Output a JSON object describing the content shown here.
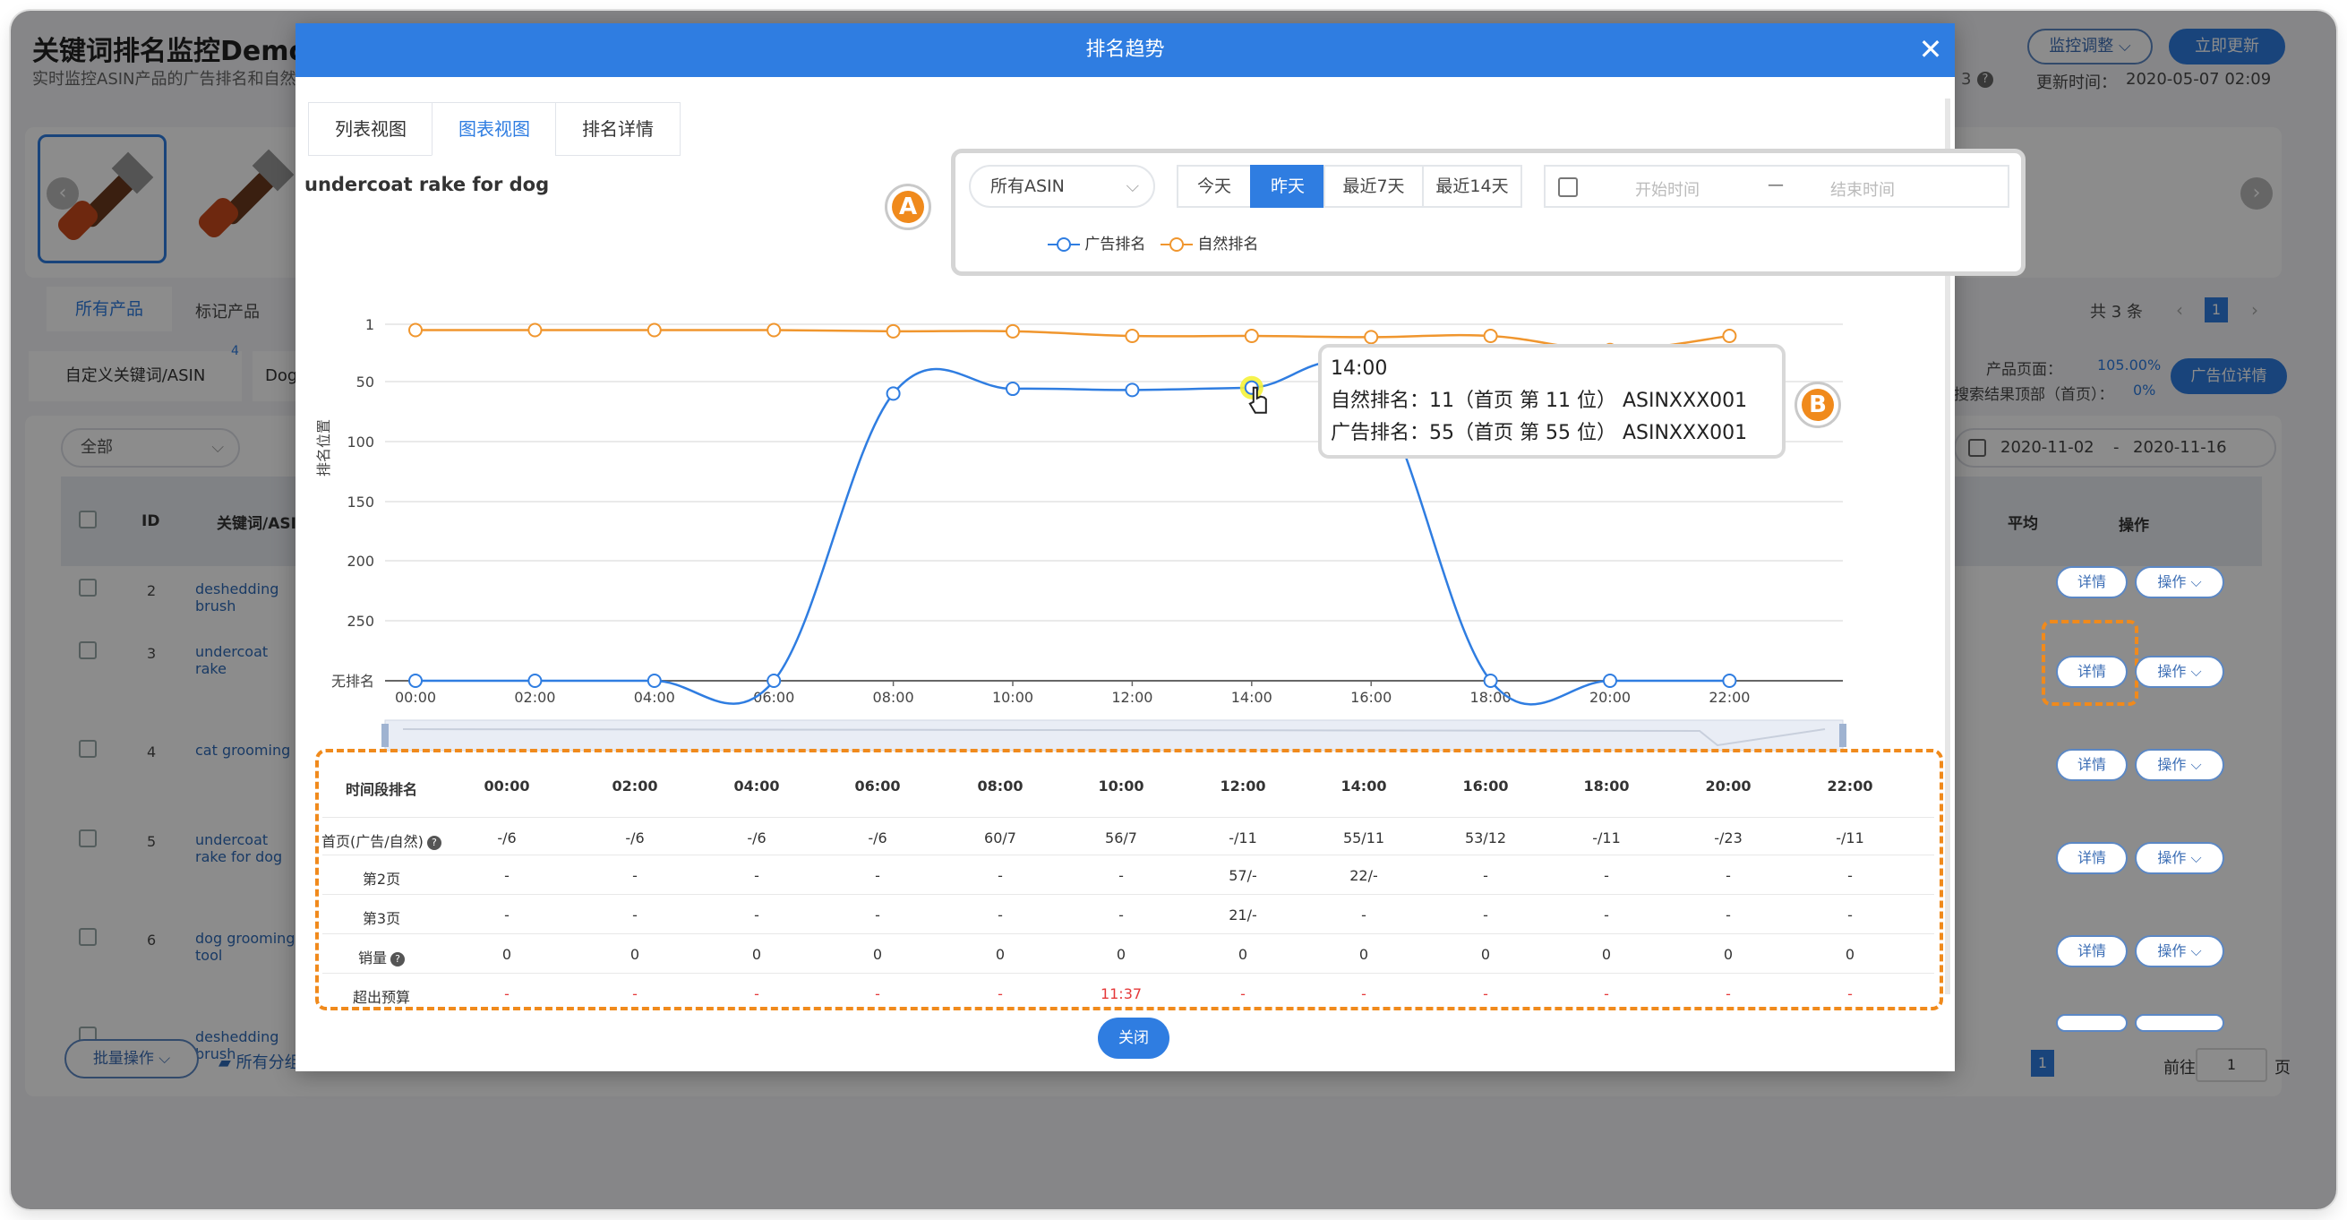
{
  "app": {
    "title": "关键词排名监控Demo",
    "subtitle": "实时监控ASIN产品的广告排名和自然排名",
    "count_suffix": "3",
    "update_time_label": "更新时间：",
    "update_time": "2020-05-07 02:09",
    "btn_adjust": "监控调整",
    "btn_update": "立即更新"
  },
  "bg": {
    "filter_tabs": [
      "所有产品",
      "标记产品"
    ],
    "custom_kw": "自定义关键词/ASIN",
    "custom_kw_count": "4",
    "custom_kw_next": "Dog",
    "total": "共 3 条",
    "page": "1",
    "product_page_label": "产品页面：",
    "product_page_val": "105.00%",
    "search_top_label": "搜索结果顶部（首页）：",
    "search_top_val": "0%",
    "ad_pos_btn": "广告位详情",
    "select_all": "全部",
    "date_from": "2020-11-02",
    "date_to": "2020-11-16",
    "col_id": "ID",
    "col_kw": "关键词/ASIN",
    "col_avg": "平均",
    "col_op": "操作",
    "rows": [
      {
        "id": "2",
        "kw": "deshedding brush"
      },
      {
        "id": "3",
        "kw": "undercoat rake"
      },
      {
        "id": "4",
        "kw": "cat grooming"
      },
      {
        "id": "5",
        "kw": "undercoat rake for dog"
      },
      {
        "id": "6",
        "kw": "dog grooming tool"
      },
      {
        "id": "",
        "kw": "deshedding brush"
      }
    ],
    "detail": "详情",
    "op": "操作",
    "batch": "批量操作",
    "groups": "所有分组",
    "goto": "前往",
    "goto_page": "1",
    "page_unit": "页"
  },
  "modal": {
    "title": "排名趋势",
    "tabs": [
      "列表视图",
      "图表视图",
      "排名详情"
    ],
    "keyword": "undercoat rake for dog",
    "asin_select": "所有ASIN",
    "ranges": [
      "今天",
      "昨天",
      "最近7天",
      "最近14天"
    ],
    "start": "开始时间",
    "end": "结束时间",
    "date_sep": "—",
    "close": "关闭",
    "badge_a": "A",
    "badge_b": "B"
  },
  "chart_data": {
    "type": "line",
    "ylabel": "排名位置",
    "x": [
      "00:00",
      "02:00",
      "04:00",
      "06:00",
      "08:00",
      "10:00",
      "12:00",
      "14:00",
      "16:00",
      "18:00",
      "20:00",
      "22:00"
    ],
    "y_ticks": [
      "1",
      "50",
      "100",
      "150",
      "200",
      "250",
      "无排名"
    ],
    "series": [
      {
        "name": "广告排名",
        "color": "#2f7de1",
        "values": [
          null,
          null,
          null,
          null,
          60,
          56,
          57,
          55,
          53,
          null,
          null,
          null
        ]
      },
      {
        "name": "自然排名",
        "color": "#f0962e",
        "values": [
          6,
          6,
          6,
          6,
          7,
          7,
          11,
          11,
          12,
          11,
          23,
          11
        ]
      }
    ],
    "tooltip": {
      "time": "14:00",
      "line1": "自然排名：11（首页 第 11 位） ASINXXX001",
      "line2": "广告排名：55（首页 第 55 位） ASINXXX001"
    }
  },
  "table": {
    "header": "时间段排名",
    "times": [
      "00:00",
      "02:00",
      "04:00",
      "06:00",
      "08:00",
      "10:00",
      "12:00",
      "14:00",
      "16:00",
      "18:00",
      "20:00",
      "22:00"
    ],
    "rows": [
      {
        "label": "首页(广告/自然)",
        "help": true,
        "values": [
          "-/6",
          "-/6",
          "-/6",
          "-/6",
          "60/7",
          "56/7",
          "-/11",
          "55/11",
          "53/12",
          "-/11",
          "-/23",
          "-/11"
        ]
      },
      {
        "label": "第2页",
        "help": false,
        "values": [
          "-",
          "-",
          "-",
          "-",
          "-",
          "-",
          "57/-",
          "22/-",
          "-",
          "-",
          "-",
          "-"
        ]
      },
      {
        "label": "第3页",
        "help": false,
        "values": [
          "-",
          "-",
          "-",
          "-",
          "-",
          "-",
          "21/-",
          "-",
          "-",
          "-",
          "-",
          "-"
        ]
      },
      {
        "label": "销量",
        "help": true,
        "values": [
          "0",
          "0",
          "0",
          "0",
          "0",
          "0",
          "0",
          "0",
          "0",
          "0",
          "0",
          "0"
        ]
      },
      {
        "label": "超出预算",
        "help": false,
        "red": true,
        "values": [
          "-",
          "-",
          "-",
          "-",
          "-",
          "11:37",
          "-",
          "-",
          "-",
          "-",
          "-",
          "-"
        ]
      }
    ]
  }
}
